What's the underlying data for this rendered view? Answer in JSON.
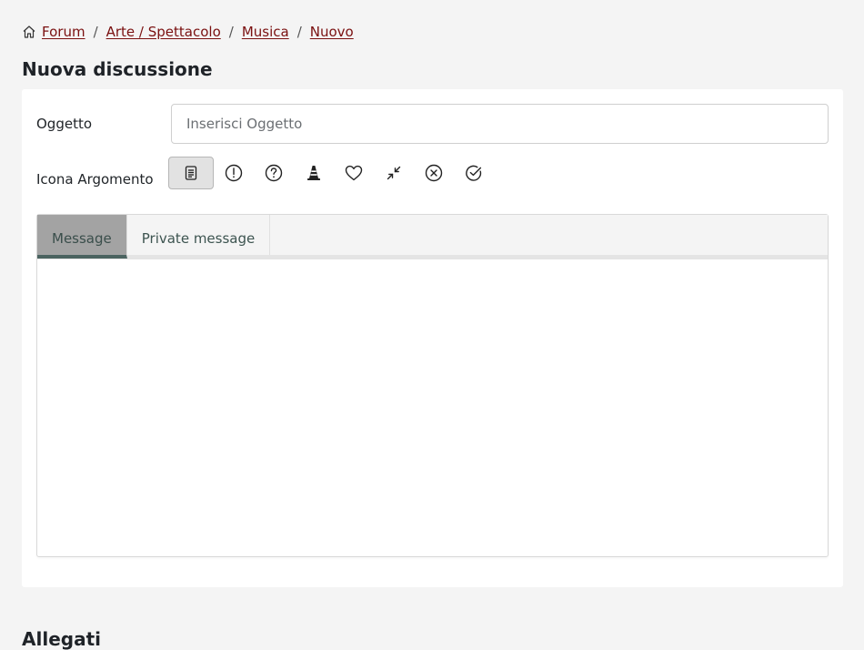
{
  "breadcrumb": {
    "items": [
      "Forum",
      "Arte / Spettacolo",
      "Musica",
      "Nuovo"
    ],
    "separator": "/",
    "home_icon": "home-icon",
    "link_color": "#7a1010"
  },
  "page_title": "Nuova discussione",
  "form": {
    "subject_label": "Oggetto",
    "subject_placeholder": "Inserisci Oggetto",
    "subject_value": "",
    "topic_icon_label": "Icona Argomento",
    "topic_icons": [
      {
        "name": "document-icon",
        "selected": true
      },
      {
        "name": "exclamation-icon",
        "selected": false
      },
      {
        "name": "question-icon",
        "selected": false
      },
      {
        "name": "cone-icon",
        "selected": false
      },
      {
        "name": "heart-icon",
        "selected": false
      },
      {
        "name": "collapse-icon",
        "selected": false
      },
      {
        "name": "x-circle-icon",
        "selected": false
      },
      {
        "name": "check-circle-icon",
        "selected": false
      }
    ]
  },
  "editor": {
    "tabs": [
      {
        "label": "Message",
        "active": true
      },
      {
        "label": "Private message",
        "active": false
      }
    ],
    "content": ""
  },
  "next_heading": "Allegati",
  "colors": {
    "background": "#f4f4f4",
    "card": "#ffffff",
    "active_tab": "#a3a3a3",
    "active_tab_underline": "#4b6360"
  }
}
